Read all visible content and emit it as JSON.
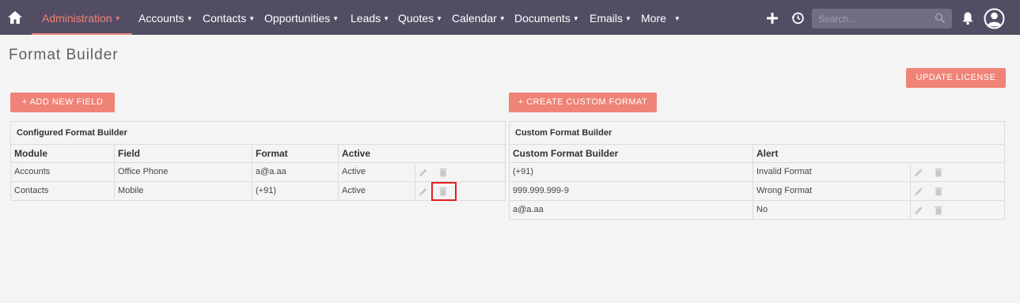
{
  "nav": {
    "home_icon": "home-icon",
    "items": [
      {
        "label": "Administration",
        "active": true
      },
      {
        "label": "Accounts"
      },
      {
        "label": "Contacts"
      },
      {
        "label": "Opportunities"
      },
      {
        "label": "Leads"
      },
      {
        "label": "Quotes"
      },
      {
        "label": "Calendar"
      },
      {
        "label": "Documents"
      },
      {
        "label": "Emails"
      },
      {
        "label": "More"
      }
    ],
    "search_placeholder": "Search...",
    "accent_color": "#f08377",
    "bar_color": "#534d64"
  },
  "page": {
    "title": "Format Builder"
  },
  "buttons": {
    "update_license": "UPDATE LICENSE",
    "add_new_field": "+ ADD NEW FIELD",
    "create_custom_format": "+ CREATE CUSTOM FORMAT"
  },
  "configured": {
    "title": "Configured Format Builder",
    "columns": [
      "Module",
      "Field",
      "Format",
      "Active"
    ],
    "rows": [
      {
        "module": "Accounts",
        "field": "Office Phone",
        "format": "a@a.aa",
        "active": "Active"
      },
      {
        "module": "Contacts",
        "field": "Mobile",
        "format": "(+91)",
        "active": "Active"
      }
    ]
  },
  "custom": {
    "title": "Custom Format Builder",
    "columns": [
      "Custom Format Builder",
      "Alert"
    ],
    "rows": [
      {
        "format": "(+91)",
        "alert": "Invalid Format"
      },
      {
        "format": "999.999.999-9",
        "alert": "Wrong Format"
      },
      {
        "format": "a@a.aa",
        "alert": "No"
      }
    ]
  }
}
